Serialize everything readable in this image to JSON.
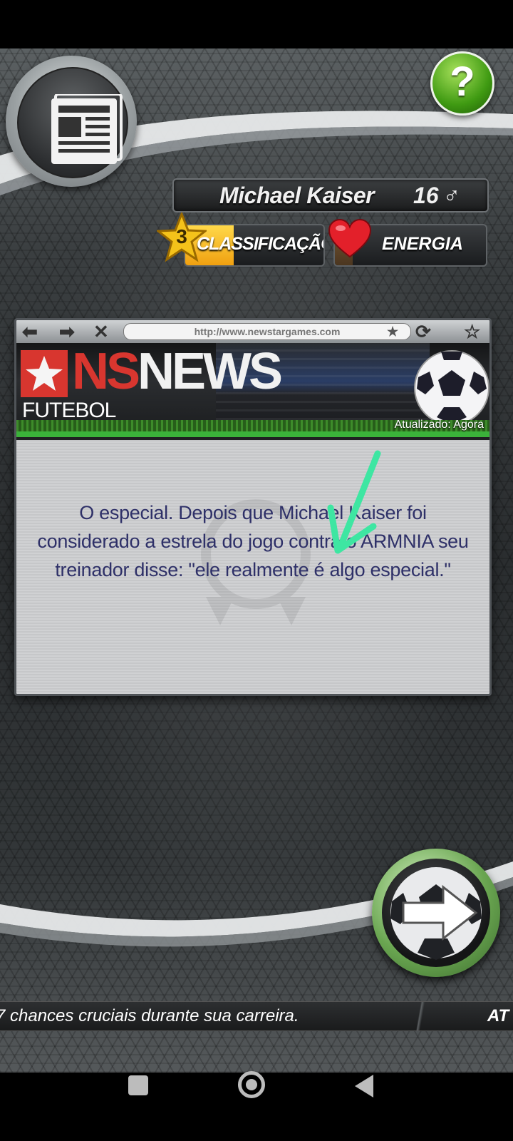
{
  "header": {
    "player_name": "Michael Kaiser",
    "player_age": "16",
    "gender_symbol": "♂",
    "help_label": "?"
  },
  "stats": {
    "rank_label": "CLASSIFICAÇÃO",
    "rank_level": "3",
    "rank_progress": 0.35,
    "energy_label": "ENERGIA",
    "energy_progress": 0.12
  },
  "browser": {
    "url": "http://www.newstargames.com",
    "brand_ns": "NS",
    "brand_news": "NEWS",
    "section": "FUTEBOL",
    "updated": "Atualizado: Agora",
    "article": "O especial. Depois que Michael Kaiser foi considerado a estrela do jogo contra o ARMNIA seu treinador disse: \"ele realmente é algo especial.\""
  },
  "ticker": {
    "text": "7 chances cruciais durante sua carreira.",
    "next_text": "AT"
  },
  "colors": {
    "news_text": "#2e3068",
    "annotation_arrow": "#3ee6a2",
    "help_green": "#3f9a12",
    "rank_gold": "#f0a010"
  },
  "icons": {
    "news": "newspaper-icon",
    "help": "question-mark-icon",
    "rank": "star-icon",
    "energy": "heart-icon",
    "next": "soccer-ball-arrow-icon"
  }
}
